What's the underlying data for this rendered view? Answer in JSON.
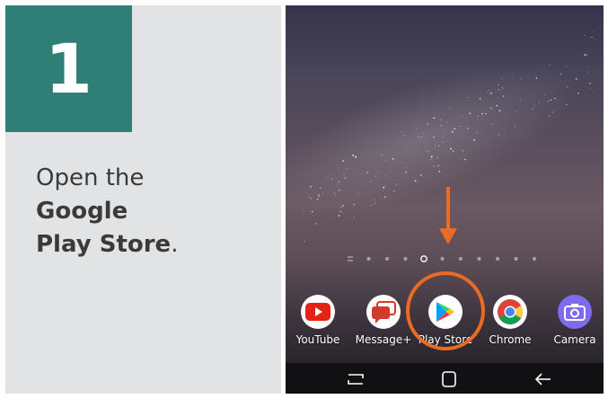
{
  "step": {
    "number": "1"
  },
  "instruction": {
    "line1": "Open the",
    "line2": "Google",
    "line3_bold": "Play Store",
    "line3_end": "."
  },
  "phone": {
    "page_indicator": {
      "pages": 11,
      "current": 4
    },
    "dock_apps": [
      {
        "label": "YouTube",
        "icon": "youtube-icon"
      },
      {
        "label": "Message+",
        "icon": "messages-icon"
      },
      {
        "label": "Play Store",
        "icon": "play-store-icon"
      },
      {
        "label": "Chrome",
        "icon": "chrome-icon"
      },
      {
        "label": "Camera",
        "icon": "camera-icon"
      }
    ],
    "highlight_color": "#e96b24",
    "navbar": [
      "recents-icon",
      "home-icon",
      "back-icon"
    ]
  },
  "colors": {
    "step_box": "#2f7f77",
    "panel": "#e2e3e4",
    "text": "#3a3a3a"
  }
}
